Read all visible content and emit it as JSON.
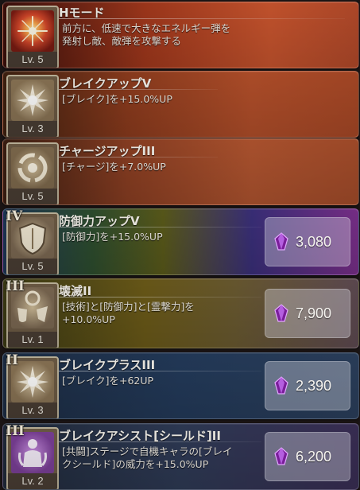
{
  "skills": [
    {
      "tier": "",
      "name": "Hモード",
      "desc": [
        "前方に、低速で大きなエネルギー弾を",
        "発射し敵、敵弾を攻撃する"
      ],
      "level": "Lv. 5",
      "price": "",
      "icon": "flare-icon",
      "icon_color": "#e5592b",
      "bg": [
        "#3a0f0b",
        "#a2381c",
        "#c9552e"
      ]
    },
    {
      "tier": "",
      "name": "ブレイクアップV",
      "desc": [
        "[ブレイク]を+15.0%UP"
      ],
      "level": "Lv. 3",
      "price": "",
      "icon": "burst-icon",
      "icon_color": "#7b6852",
      "bg": [
        "#3d2010",
        "#8c3b1d",
        "#b34f2a"
      ]
    },
    {
      "tier": "",
      "name": "チャージアップIII",
      "desc": [
        "[チャージ]を+7.0%UP"
      ],
      "level": "Lv. 5",
      "price": "",
      "icon": "swirl-icon",
      "icon_color": "#7b6852",
      "bg": [
        "#3a1e12",
        "#8a3e22",
        "#b0542f"
      ]
    },
    {
      "tier": "IV",
      "name": "防御力アップV",
      "desc": [
        "[防御力]を+15.0%UP"
      ],
      "level": "Lv. 5",
      "price": "3,080",
      "icon": "shield-icon",
      "icon_color": "#7b6852",
      "bg": [
        "#1b3552",
        "#4a2f7a",
        "#7a2f7a"
      ]
    },
    {
      "tier": "III",
      "name": "壊滅II",
      "desc": [
        "[技術]と[防御力]と[霊撃力]を",
        "+10.0%UP"
      ],
      "level": "Lv. 1",
      "price": "7,900",
      "icon": "trio-icon",
      "icon_color": "#7b6852",
      "bg": [
        "#3b3a14",
        "#6b5a18",
        "#5e4a52"
      ]
    },
    {
      "tier": "II",
      "name": "ブレイクプラスIII",
      "desc": [
        "[ブレイク]を+62UP"
      ],
      "level": "Lv. 3",
      "price": "2,390",
      "icon": "burst-icon",
      "icon_color": "#7b6852",
      "bg": [
        "#1d2d44",
        "#233a5a",
        "#2b3f5c"
      ]
    },
    {
      "tier": "III",
      "name": "ブレイクアシスト[シールド]II",
      "desc": [
        "[共闘]ステージで自機キャラの[ブレイ",
        "クシールド]の威力を+15.0%UP"
      ],
      "level": "Lv. 2",
      "price": "6,200",
      "icon": "assist-icon",
      "icon_color": "#8a4fa6",
      "bg": [
        "#202a3a",
        "#2e3a55",
        "#3a2e55"
      ]
    }
  ]
}
